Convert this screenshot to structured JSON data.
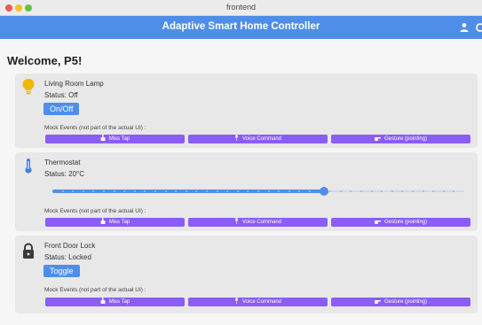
{
  "window": {
    "title": "frontend"
  },
  "appbar": {
    "title": "Adaptive Smart Home Controller",
    "icons": [
      "user-icon",
      "refresh-icon"
    ]
  },
  "welcome": "Welcome, P5!",
  "mock_events_label": "Mock Events (not part of the actual UI) :",
  "mock_buttons": {
    "miss_tap": "Miss Tap",
    "voice": "Voice Command",
    "gesture": "Gesture (pointing)"
  },
  "devices": [
    {
      "name": "Living Room Lamp",
      "status": "Status: Off",
      "control": "On/Off",
      "icon": "lightbulb-icon",
      "icon_color": "#f2b705"
    },
    {
      "name": "Thermostat",
      "status": "Status: 20°C",
      "slider_level": 0.66,
      "icon": "thermometer-icon",
      "icon_color": "#3f7fe0"
    },
    {
      "name": "Front Door Lock",
      "status": "Status: Locked",
      "control": "Toggle",
      "icon": "lock-icon",
      "icon_color": "#3a3a3a"
    }
  ],
  "colors": {
    "appbar": "#4f8ee8",
    "primary_button": "#4f8ee8",
    "mock_button": "#8b5cf6",
    "card": "#e8e8e8"
  }
}
